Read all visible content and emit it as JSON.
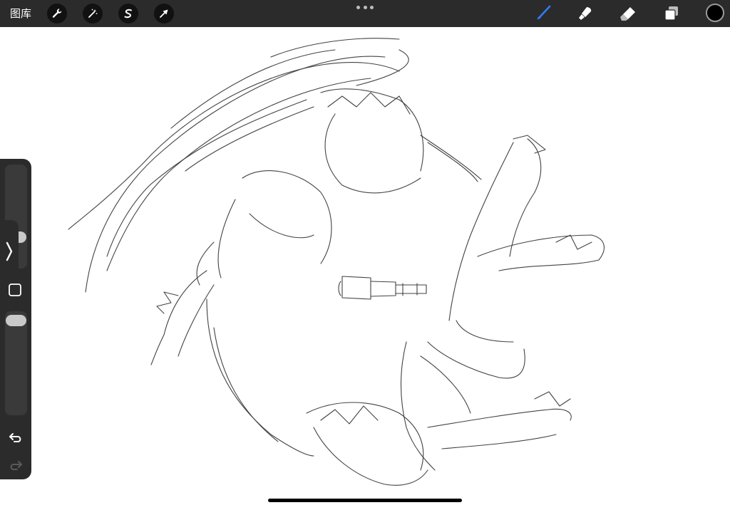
{
  "toolbar": {
    "gallery_label": "图库",
    "left_tools": [
      {
        "icon": "wrench-icon",
        "name": "actions"
      },
      {
        "icon": "magic-wand-icon",
        "name": "adjustments"
      },
      {
        "icon": "selection-s-icon",
        "name": "selection"
      },
      {
        "icon": "arrow-cursor-icon",
        "name": "transform"
      }
    ],
    "right_tools": [
      {
        "icon": "brush-icon",
        "name": "paint",
        "active": true
      },
      {
        "icon": "smudge-icon",
        "name": "smudge",
        "active": false
      },
      {
        "icon": "eraser-icon",
        "name": "erase",
        "active": false
      },
      {
        "icon": "layers-icon",
        "name": "layers",
        "active": false
      }
    ],
    "current_color": "#000000",
    "active_tool_color": "#2f7bf6"
  },
  "sidebar": {
    "brush_size_level": 0.1,
    "opacity_level": 0.95,
    "undo_icon": "undo-arrow-icon",
    "redo_icon": "redo-arrow-icon",
    "modify_icon": "square-icon",
    "expand_icon": "chevron-right-icon"
  }
}
